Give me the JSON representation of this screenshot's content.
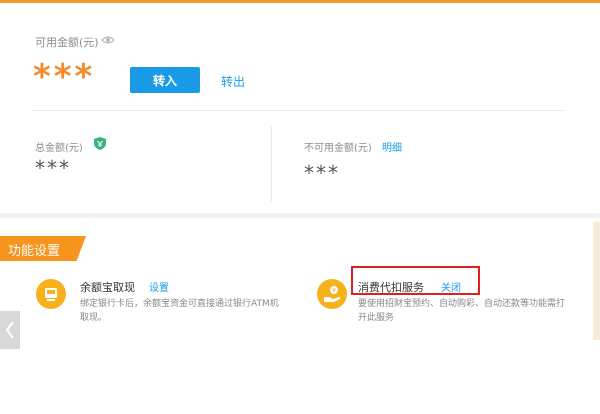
{
  "balance": {
    "available_label": "可用金额(元)",
    "available_amount": "***",
    "transfer_in_label": "转入",
    "transfer_out_label": "转出",
    "total_label": "总金额(元)",
    "total_amount": "***",
    "unavailable_label": "不可用金额(元)",
    "detail_link": "明细",
    "unavailable_amount": "***"
  },
  "settings": {
    "section_title": "功能设置",
    "features": [
      {
        "title": "余额宝取现",
        "action": "设置",
        "description": "绑定银行卡后，余额宝资金可直接通过银行ATM机取现。"
      },
      {
        "title": "消费代扣服务",
        "action": "关闭",
        "description": "要使用招财宝预约、自动购彩、自动还款等功能需打开此服务"
      }
    ]
  },
  "colors": {
    "accent_orange": "#f7941d",
    "amount_orange": "#f58b2b",
    "primary_blue": "#1a9be8",
    "highlight_red": "#e01f1f",
    "icon_yellow": "#f6b11b",
    "shield_green": "#36b37e"
  }
}
